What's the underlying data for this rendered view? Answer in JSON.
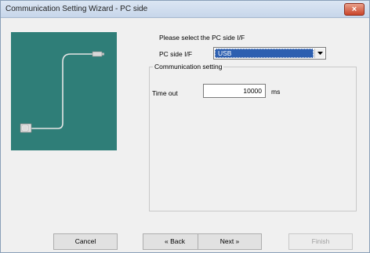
{
  "window": {
    "title": "Communication Setting Wizard - PC side",
    "close_glyph": "×"
  },
  "illustration": {
    "description_icon": "usb-cable-icon",
    "background_color": "#2f7e78"
  },
  "form": {
    "prompt": "Please select the PC side I/F",
    "pc_side_if_label": "PC side I/F",
    "pc_side_if_value": "USB",
    "group_title": "Communication setting",
    "timeout_label": "Time out",
    "timeout_value": "10000",
    "timeout_unit": "ms"
  },
  "buttons": {
    "cancel": "Cancel",
    "back": "« Back",
    "next": "Next »",
    "finish": "Finish"
  }
}
